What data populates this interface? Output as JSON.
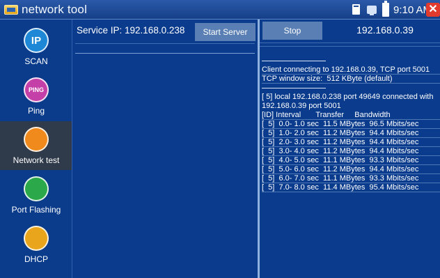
{
  "app": {
    "title": "network tool"
  },
  "status_bar": {
    "time": "9:10 AM"
  },
  "sidebar": {
    "items": [
      {
        "label": "SCAN",
        "icon": "ip-scan-icon",
        "badge": "IP",
        "color": "#1e87d6"
      },
      {
        "label": "Ping",
        "icon": "ping-icon",
        "badge": "PING",
        "color": "#c53fa8"
      },
      {
        "label": "Network test",
        "icon": "network-test-icon",
        "badge": "",
        "color": "#f08a1c",
        "active": true
      },
      {
        "label": "Port Flashing",
        "icon": "port-flashing-icon",
        "badge": "",
        "color": "#2aa84a"
      },
      {
        "label": "DHCP",
        "icon": "dhcp-icon",
        "badge": "",
        "color": "#e9a51c"
      }
    ]
  },
  "server": {
    "service_ip_label": "Service IP: 192.168.0.238",
    "start_button": "Start Server"
  },
  "client": {
    "stop_button": "Stop",
    "target_ip": "192.168.0.39",
    "log": [
      "Client connecting to 192.168.0.39, TCP port 5001",
      "TCP window size:  512 KByte (default)"
    ],
    "connection_line": "[  5] local 192.168.0.238 port 49649 connected with 192.168.0.39 port 5001",
    "table_header": "[ID] Interval       Transfer     Bandwidth",
    "intervals": [
      "[  5]  0.0- 1.0 sec  11.5 MBytes  96.5 Mbits/sec",
      "[  5]  1.0- 2.0 sec  11.2 MBytes  94.4 Mbits/sec",
      "[  5]  2.0- 3.0 sec  11.2 MBytes  94.4 Mbits/sec",
      "[  5]  3.0- 4.0 sec  11.2 MBytes  94.4 Mbits/sec",
      "[  5]  4.0- 5.0 sec  11.1 MBytes  93.3 Mbits/sec",
      "[  5]  5.0- 6.0 sec  11.2 MBytes  94.4 Mbits/sec",
      "[  5]  6.0- 7.0 sec  11.1 MBytes  93.3 Mbits/sec",
      "[  5]  7.0- 8.0 sec  11.4 MBytes  95.4 Mbits/sec"
    ]
  }
}
